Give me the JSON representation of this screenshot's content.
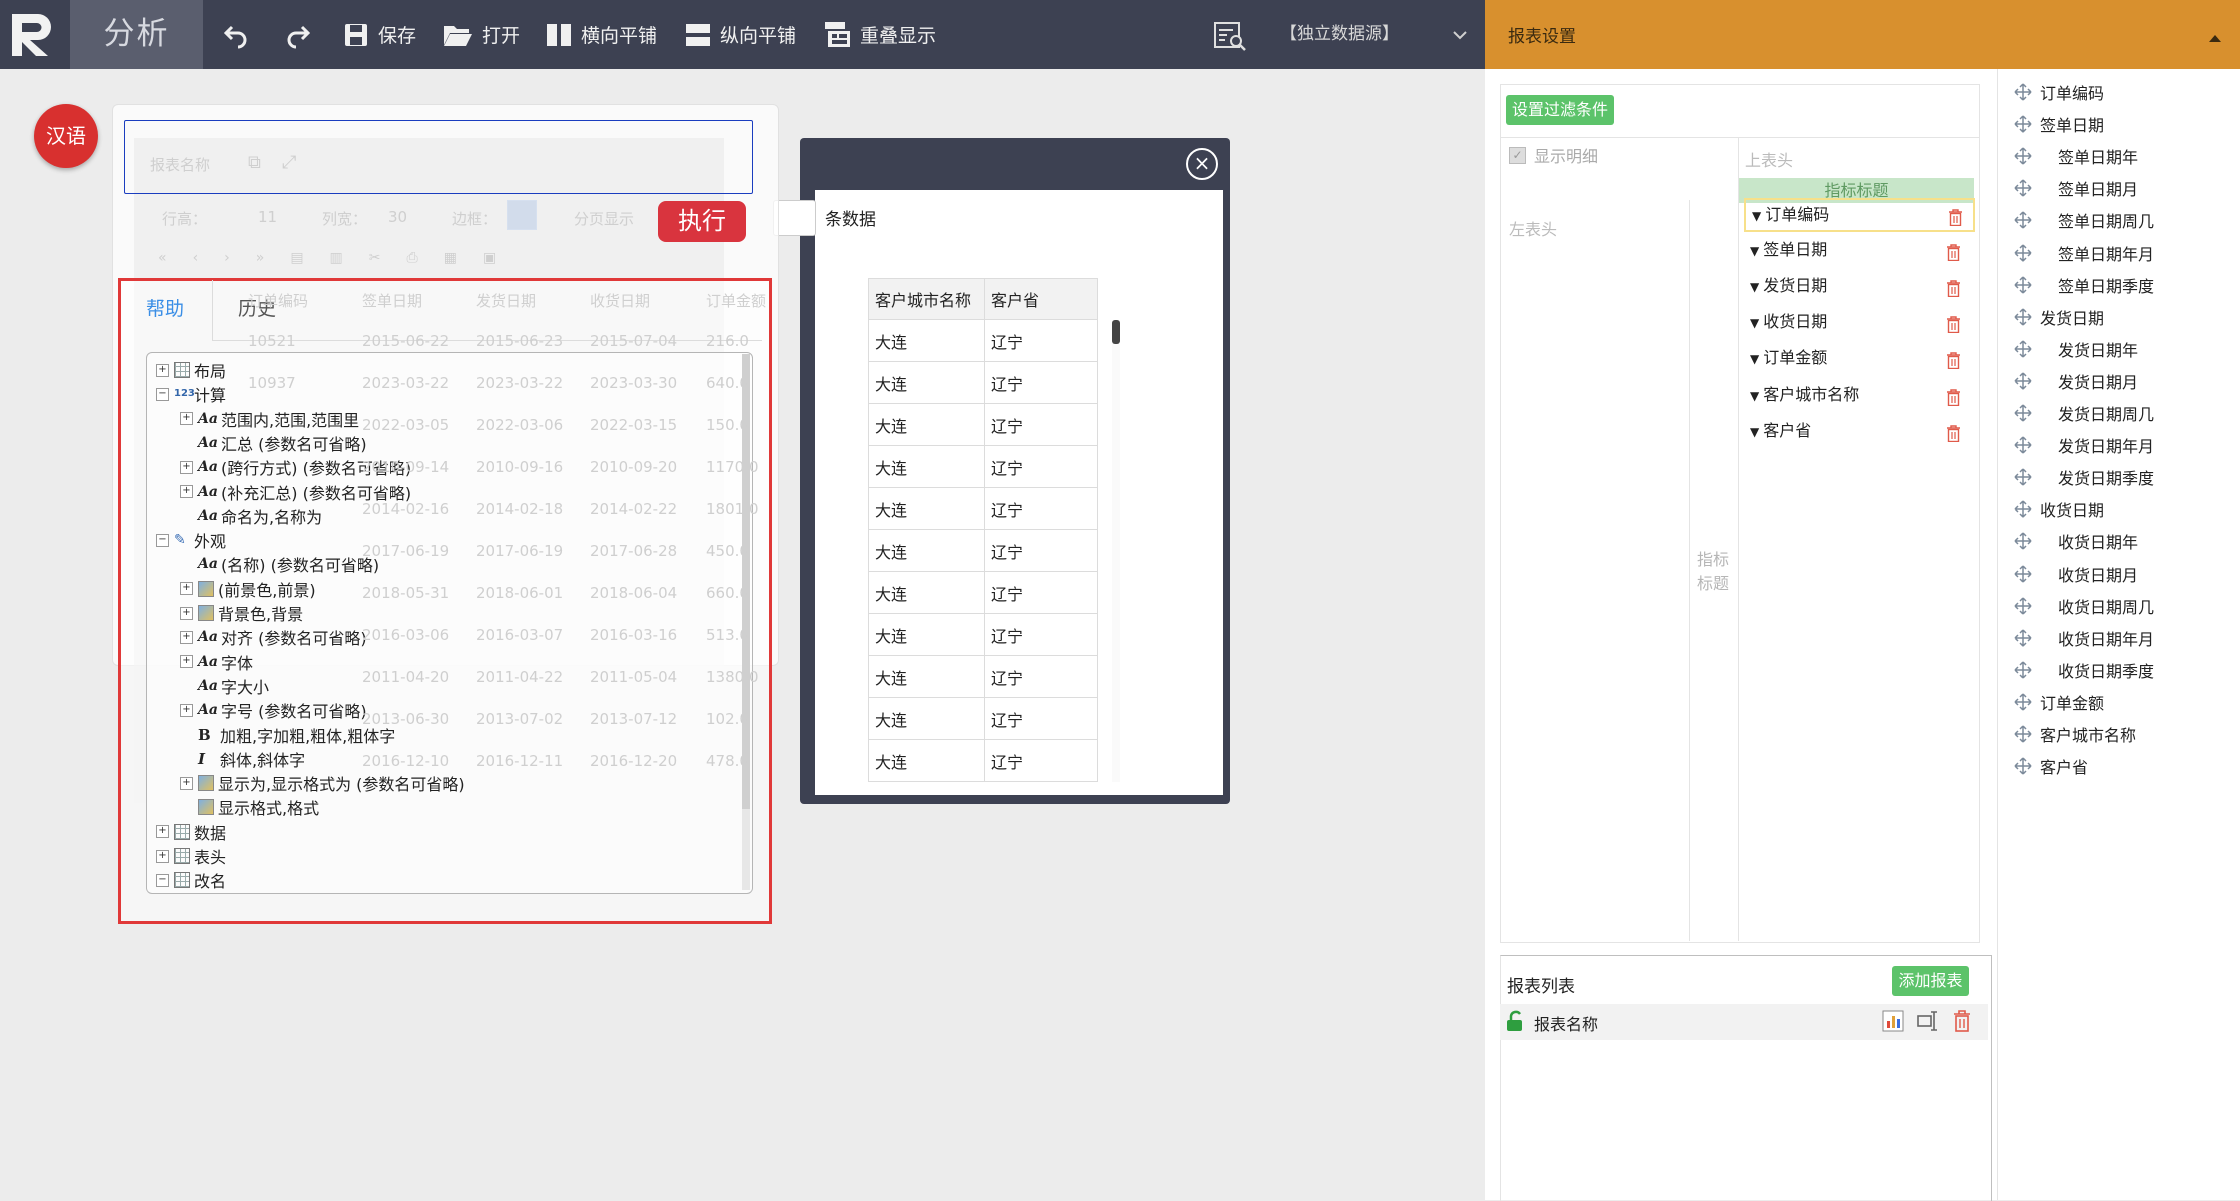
{
  "toolbar": {
    "app_title": "分析",
    "save": "保存",
    "open": "打开",
    "horizontal": "横向平铺",
    "vertical": "纵向平铺",
    "overlay": "重叠显示",
    "datasource": "【独立数据源】"
  },
  "right_header": {
    "title": "报表设置"
  },
  "settings": {
    "filter_btn": "设置过滤条件",
    "show_detail": "显示明细",
    "top_header": "上表头",
    "left_header": "左表头",
    "metric_title": "指标标题",
    "metric_title_vert": "指标标题",
    "metrics": [
      "订单编码",
      "签单日期",
      "发货日期",
      "收货日期",
      "订单金额",
      "客户城市名称",
      "客户省"
    ]
  },
  "report_list": {
    "title": "报表列表",
    "add_btn": "添加报表",
    "items": [
      "报表名称"
    ]
  },
  "field_tree": [
    {
      "label": "订单编码",
      "level": 0
    },
    {
      "label": "签单日期",
      "level": 0
    },
    {
      "label": "签单日期年",
      "level": 1
    },
    {
      "label": "签单日期月",
      "level": 1
    },
    {
      "label": "签单日期周几",
      "level": 1
    },
    {
      "label": "签单日期年月",
      "level": 1
    },
    {
      "label": "签单日期季度",
      "level": 1
    },
    {
      "label": "发货日期",
      "level": 0
    },
    {
      "label": "发货日期年",
      "level": 1
    },
    {
      "label": "发货日期月",
      "level": 1
    },
    {
      "label": "发货日期周几",
      "level": 1
    },
    {
      "label": "发货日期年月",
      "level": 1
    },
    {
      "label": "发货日期季度",
      "level": 1
    },
    {
      "label": "收货日期",
      "level": 0
    },
    {
      "label": "收货日期年",
      "level": 1
    },
    {
      "label": "收货日期月",
      "level": 1
    },
    {
      "label": "收货日期周几",
      "level": 1
    },
    {
      "label": "收货日期年月",
      "level": 1
    },
    {
      "label": "收货日期季度",
      "level": 1
    },
    {
      "label": "订单金额",
      "level": 0
    },
    {
      "label": "客户城市名称",
      "level": 0
    },
    {
      "label": "客户省",
      "level": 0
    }
  ],
  "main": {
    "lang_btn": "汉语",
    "exec_btn": "执行",
    "row_count_label": "条数据",
    "faded": {
      "report_name": "报表名称",
      "rows_label": "行高：",
      "rows_val": "11",
      "cols_label": "列宽：",
      "cols_val": "30",
      "border_label": "边框：",
      "paging": "分页显示"
    },
    "table": {
      "headers": [
        "订单编码",
        "签单日期",
        "发货日期",
        "收货日期",
        "订单金额",
        "客户城市名称",
        "客户省"
      ],
      "rows": [
        [
          "10521",
          "2015-06-22",
          "2015-06-23",
          "2015-07-04",
          "216.0",
          "大连",
          "辽宁"
        ],
        [
          "10937",
          "2023-03-22",
          "2023-03-22",
          "2023-03-30",
          "640.0",
          "大连",
          "辽宁"
        ],
        [
          "",
          "2022-03-05",
          "2022-03-06",
          "2022-03-15",
          "150.0",
          "大连",
          "辽宁"
        ],
        [
          "",
          "2010-09-14",
          "2010-09-16",
          "2010-09-20",
          "1170.0",
          "大连",
          "辽宁"
        ],
        [
          "",
          "2014-02-16",
          "2014-02-18",
          "2014-02-22",
          "1801.0",
          "大连",
          "辽宁"
        ],
        [
          "",
          "2017-06-19",
          "2017-06-19",
          "2017-06-28",
          "450.0",
          "大连",
          "辽宁"
        ],
        [
          "",
          "2018-05-31",
          "2018-06-01",
          "2018-06-04",
          "660.0",
          "大连",
          "辽宁"
        ],
        [
          "",
          "2016-03-06",
          "2016-03-07",
          "2016-03-16",
          "513.0",
          "大连",
          "辽宁"
        ],
        [
          "",
          "2011-04-20",
          "2011-04-22",
          "2011-05-04",
          "1380.0",
          "大连",
          "辽宁"
        ],
        [
          "",
          "2013-06-30",
          "2013-07-02",
          "2013-07-12",
          "102.0",
          "大连",
          "辽宁"
        ],
        [
          "",
          "2016-12-10",
          "2016-12-11",
          "2016-12-20",
          "478.0",
          "大连",
          "辽宁"
        ]
      ]
    }
  },
  "help": {
    "tab_help": "帮助",
    "tab_history": "历史",
    "tree": [
      {
        "label": "布局",
        "level": 0,
        "pm": "+",
        "icon": "grid"
      },
      {
        "label": "计算",
        "level": 0,
        "pm": "-",
        "icon": "calc"
      },
      {
        "label": "范围内,范围,范围里",
        "level": 1,
        "pm": "+",
        "icon": "aa"
      },
      {
        "label": "汇总 (参数名可省略)",
        "level": 1,
        "pm": "",
        "icon": "aa"
      },
      {
        "label": "(跨行方式) (参数名可省略)",
        "level": 1,
        "pm": "+",
        "icon": "aa"
      },
      {
        "label": "(补充汇总) (参数名可省略)",
        "level": 1,
        "pm": "+",
        "icon": "aa"
      },
      {
        "label": "命名为,名称为",
        "level": 1,
        "pm": "",
        "icon": "aa"
      },
      {
        "label": "外观",
        "level": 0,
        "pm": "-",
        "icon": "pen"
      },
      {
        "label": "(名称) (参数名可省略)",
        "level": 1,
        "pm": "",
        "icon": "aa"
      },
      {
        "label": "(前景色,前景)",
        "level": 1,
        "pm": "+",
        "icon": "img"
      },
      {
        "label": "背景色,背景",
        "level": 1,
        "pm": "+",
        "icon": "img"
      },
      {
        "label": "对齐 (参数名可省略)",
        "level": 1,
        "pm": "+",
        "icon": "aa"
      },
      {
        "label": "字体",
        "level": 1,
        "pm": "+",
        "icon": "aa"
      },
      {
        "label": "字大小",
        "level": 1,
        "pm": "",
        "icon": "aa"
      },
      {
        "label": "字号 (参数名可省略)",
        "level": 1,
        "pm": "+",
        "icon": "aa"
      },
      {
        "label": "加粗,字加粗,粗体,粗体字",
        "level": 1,
        "pm": "",
        "icon": "b"
      },
      {
        "label": "斜体,斜体字",
        "level": 1,
        "pm": "",
        "icon": "i"
      },
      {
        "label": "显示为,显示格式为 (参数名可省略)",
        "level": 1,
        "pm": "+",
        "icon": "img"
      },
      {
        "label": "显示格式,格式",
        "level": 1,
        "pm": "",
        "icon": "img"
      },
      {
        "label": "数据",
        "level": 0,
        "pm": "+",
        "icon": "grid"
      },
      {
        "label": "表头",
        "level": 0,
        "pm": "+",
        "icon": "grid"
      },
      {
        "label": "改名",
        "level": 0,
        "pm": "-",
        "icon": "grid"
      }
    ]
  },
  "colors": {
    "accent_orange": "#d8902e",
    "toolbar_bg": "#3d4152",
    "green": "#5cc36a",
    "red": "#d9343e"
  }
}
